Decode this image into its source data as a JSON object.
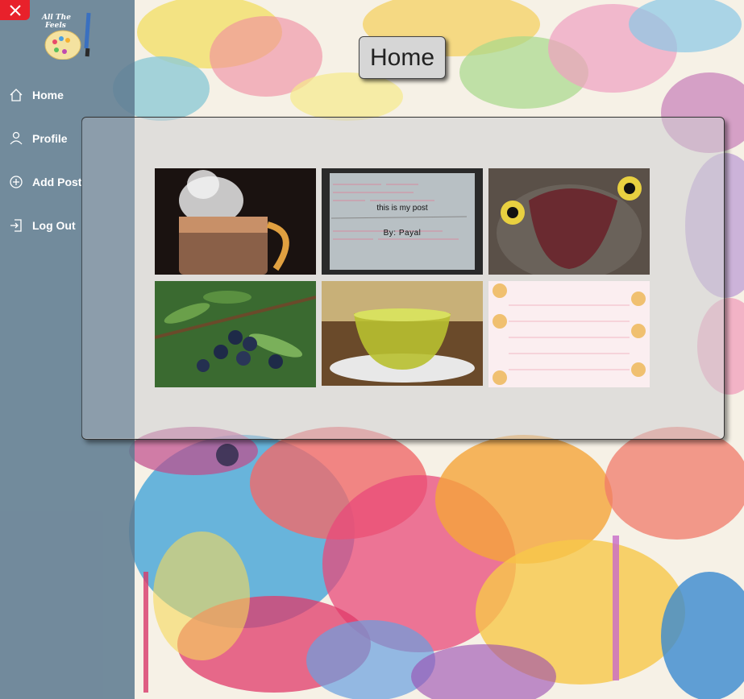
{
  "app": {
    "logo_text": "All The Feels"
  },
  "sidebar": {
    "items": [
      {
        "label": "Home",
        "icon": "home-icon"
      },
      {
        "label": "Profile",
        "icon": "user-icon"
      },
      {
        "label": "Add Post",
        "icon": "plus-circle-icon"
      },
      {
        "label": "Log Out",
        "icon": "logout-icon"
      }
    ]
  },
  "header": {
    "title": "Home"
  },
  "posts": [
    {
      "image": "steaming coffee mug"
    },
    {
      "image": "handwritten note",
      "title": "this is my post",
      "author": "By: Payal"
    },
    {
      "image": "bird with open beak"
    },
    {
      "image": "blueberry branch"
    },
    {
      "image": "cup of green tea"
    },
    {
      "image": "cute kitten stationery"
    }
  ],
  "colors": {
    "close": "#e8212b",
    "sidebar": "#607c92"
  }
}
